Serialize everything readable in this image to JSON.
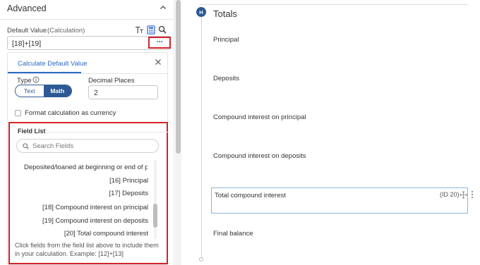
{
  "left_panel": {
    "section_title": "Advanced",
    "default_value_label": "Default Value",
    "default_value_mode": "(Calculation)",
    "formula": "[18]+[19]",
    "more_button_label": "···",
    "calc_panel": {
      "tab_label": "Calculate Default Value",
      "type_label": "Type",
      "type_options": [
        "Text",
        "Math"
      ],
      "type_selected": "Math",
      "decimal_places_label": "Decimal Places",
      "decimal_places_value": "2",
      "currency_checkbox_label": "Format calculation as currency",
      "currency_checked": false
    },
    "field_list": {
      "title": "Field List",
      "search_placeholder": "Search Fields",
      "truncated_item": "Deposited/loaned at beginning or end of peri",
      "items": [
        "[16]  Principal",
        "[17]  Deposits",
        "[18]  Compound interest on principal",
        "[19]  Compound interest on deposits",
        "[20]  Total compound interest"
      ],
      "help_text": "Click fields from the field list above to include them in your calculation. Example: [12]+[13]"
    }
  },
  "right_panel": {
    "badge": "H",
    "section_title": "Totals",
    "fields": [
      "Principal",
      "Deposits",
      "Compound interest on principal",
      "Compound interest on deposits"
    ],
    "selected_field": {
      "label": "Total compound interest",
      "id_tag": "(ID 20)"
    },
    "final_field": "Final balance"
  },
  "colors": {
    "accent_blue": "#2a69c7",
    "toggle_navy": "#2d5a94",
    "highlight_red": "#d0232a",
    "selected_border": "#8fb3d9"
  },
  "icons": [
    "chevron-up-icon",
    "text-size-icon",
    "calculator-icon",
    "zoom-icon",
    "close-icon",
    "info-icon",
    "search-icon",
    "move-icon",
    "kebab-icon"
  ]
}
